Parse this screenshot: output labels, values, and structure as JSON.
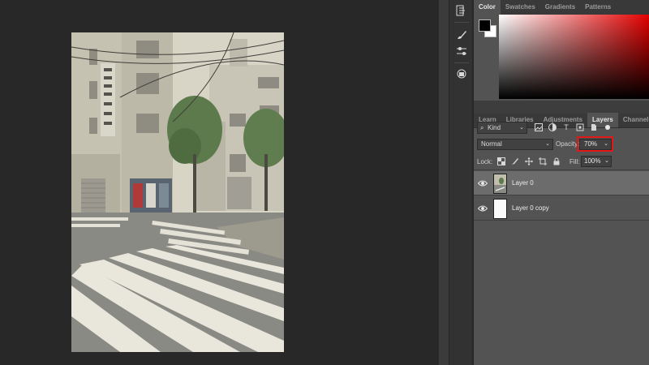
{
  "color_panel": {
    "tabs": [
      "Color",
      "Swatches",
      "Gradients",
      "Patterns"
    ],
    "foreground": "#000000",
    "background": "#ffffff",
    "hue": "#e40000"
  },
  "layers_panel": {
    "tabs": [
      "Learn",
      "Libraries",
      "Adjustments",
      "Layers",
      "Channels"
    ],
    "active_tab": "Layers",
    "filter_kind": "Kind",
    "blend_mode": "Normal",
    "opacity_label": "Opacity:",
    "opacity_value": "70%",
    "lock_label": "Lock:",
    "fill_label": "Fill:",
    "fill_value": "100%",
    "highlight_color": "#e01818",
    "layers": [
      {
        "name": "Layer 0",
        "selected": true,
        "visible": true
      },
      {
        "name": "Layer 0 copy",
        "selected": false,
        "visible": true
      }
    ]
  },
  "toolbar": {
    "icons": [
      "history-icon",
      "brush-settings-icon",
      "properties-icon",
      "3d-icon"
    ]
  },
  "canvas": {
    "image": "street-crosswalk-photo"
  }
}
